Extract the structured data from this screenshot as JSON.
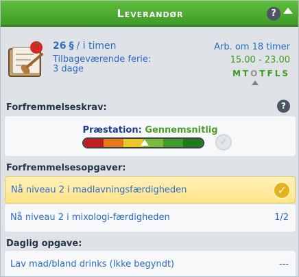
{
  "header": {
    "title": "Leverandør",
    "help": "?"
  },
  "job": {
    "pay_amount": "26",
    "pay_currency": "§",
    "pay_unit": "/ i timen",
    "vacation_label": "Tilbageværende ferie:",
    "vacation_days": "3 dage",
    "work_in": "Arb. om 18 timer",
    "hours": "15.00 - 23.00",
    "days": [
      {
        "letter": "M",
        "works": true
      },
      {
        "letter": "T",
        "works": true
      },
      {
        "letter": "O",
        "works": false
      },
      {
        "letter": "T",
        "works": true
      },
      {
        "letter": "F",
        "works": true
      },
      {
        "letter": "L",
        "works": true
      },
      {
        "letter": "S",
        "works": true
      }
    ]
  },
  "promotion": {
    "title": "Forfremmelseskrav:",
    "help": "?",
    "performance_key": "Præstation:",
    "performance_value": "Gennemsnitlig",
    "meter_colors": [
      "#c0201f",
      "#e67a1c",
      "#e9c62a",
      "#7dbb3c",
      "#3d9a2b",
      "#1f7a22"
    ]
  },
  "tasks": {
    "title": "Forfremmelsesopgaver:",
    "items": [
      {
        "text": "Nå niveau 2 i madlavningsfærdigheden",
        "status": "",
        "complete": true
      },
      {
        "text": "Nå niveau 2 i mixologi-færdigheden",
        "status": "1/2",
        "complete": false
      }
    ]
  },
  "daily": {
    "title": "Daglig opgave:",
    "items": [
      {
        "text": "Lav mad/bland drinks (Ikke begyndt)",
        "status": "---"
      }
    ]
  }
}
